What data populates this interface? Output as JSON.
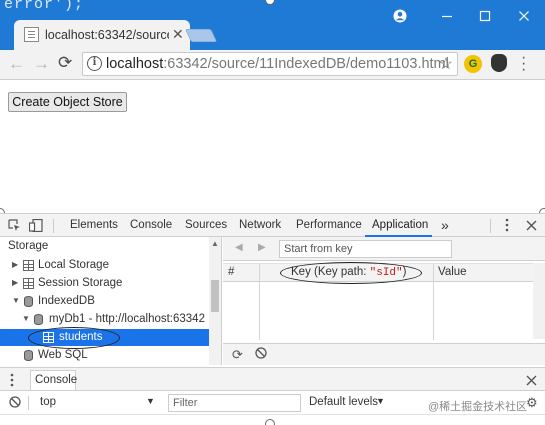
{
  "code_fragment": "error');",
  "browser": {
    "tab_title": "localhost:63342/source",
    "url_host": "localhost",
    "url_path": ":63342/source/11IndexedDB/demo1103.html"
  },
  "page": {
    "button_label": "Create Object Store"
  },
  "devtools": {
    "tabs": [
      "Elements",
      "Console",
      "Sources",
      "Network",
      "Performance",
      "Application"
    ],
    "more_tabs": "»",
    "sidebar": {
      "heading": "Storage",
      "items": [
        {
          "label": "Local Storage"
        },
        {
          "label": "Session Storage"
        },
        {
          "label": "IndexedDB"
        },
        {
          "label": "myDb1 - http://localhost:63342"
        },
        {
          "label": "students"
        },
        {
          "label": "Web SQL"
        }
      ]
    },
    "panel": {
      "start_placeholder": "Start from key",
      "col_hash": "#",
      "col_key_prefix": "Key (Key path: ",
      "col_key_path": "\"sId\"",
      "col_key_suffix": ")",
      "col_value": "Value"
    },
    "drawer": {
      "tab_label": "Console",
      "context": "top",
      "filter_placeholder": "Filter",
      "levels": "Default levels"
    }
  },
  "watermark": "@稀土掘金技术社区"
}
